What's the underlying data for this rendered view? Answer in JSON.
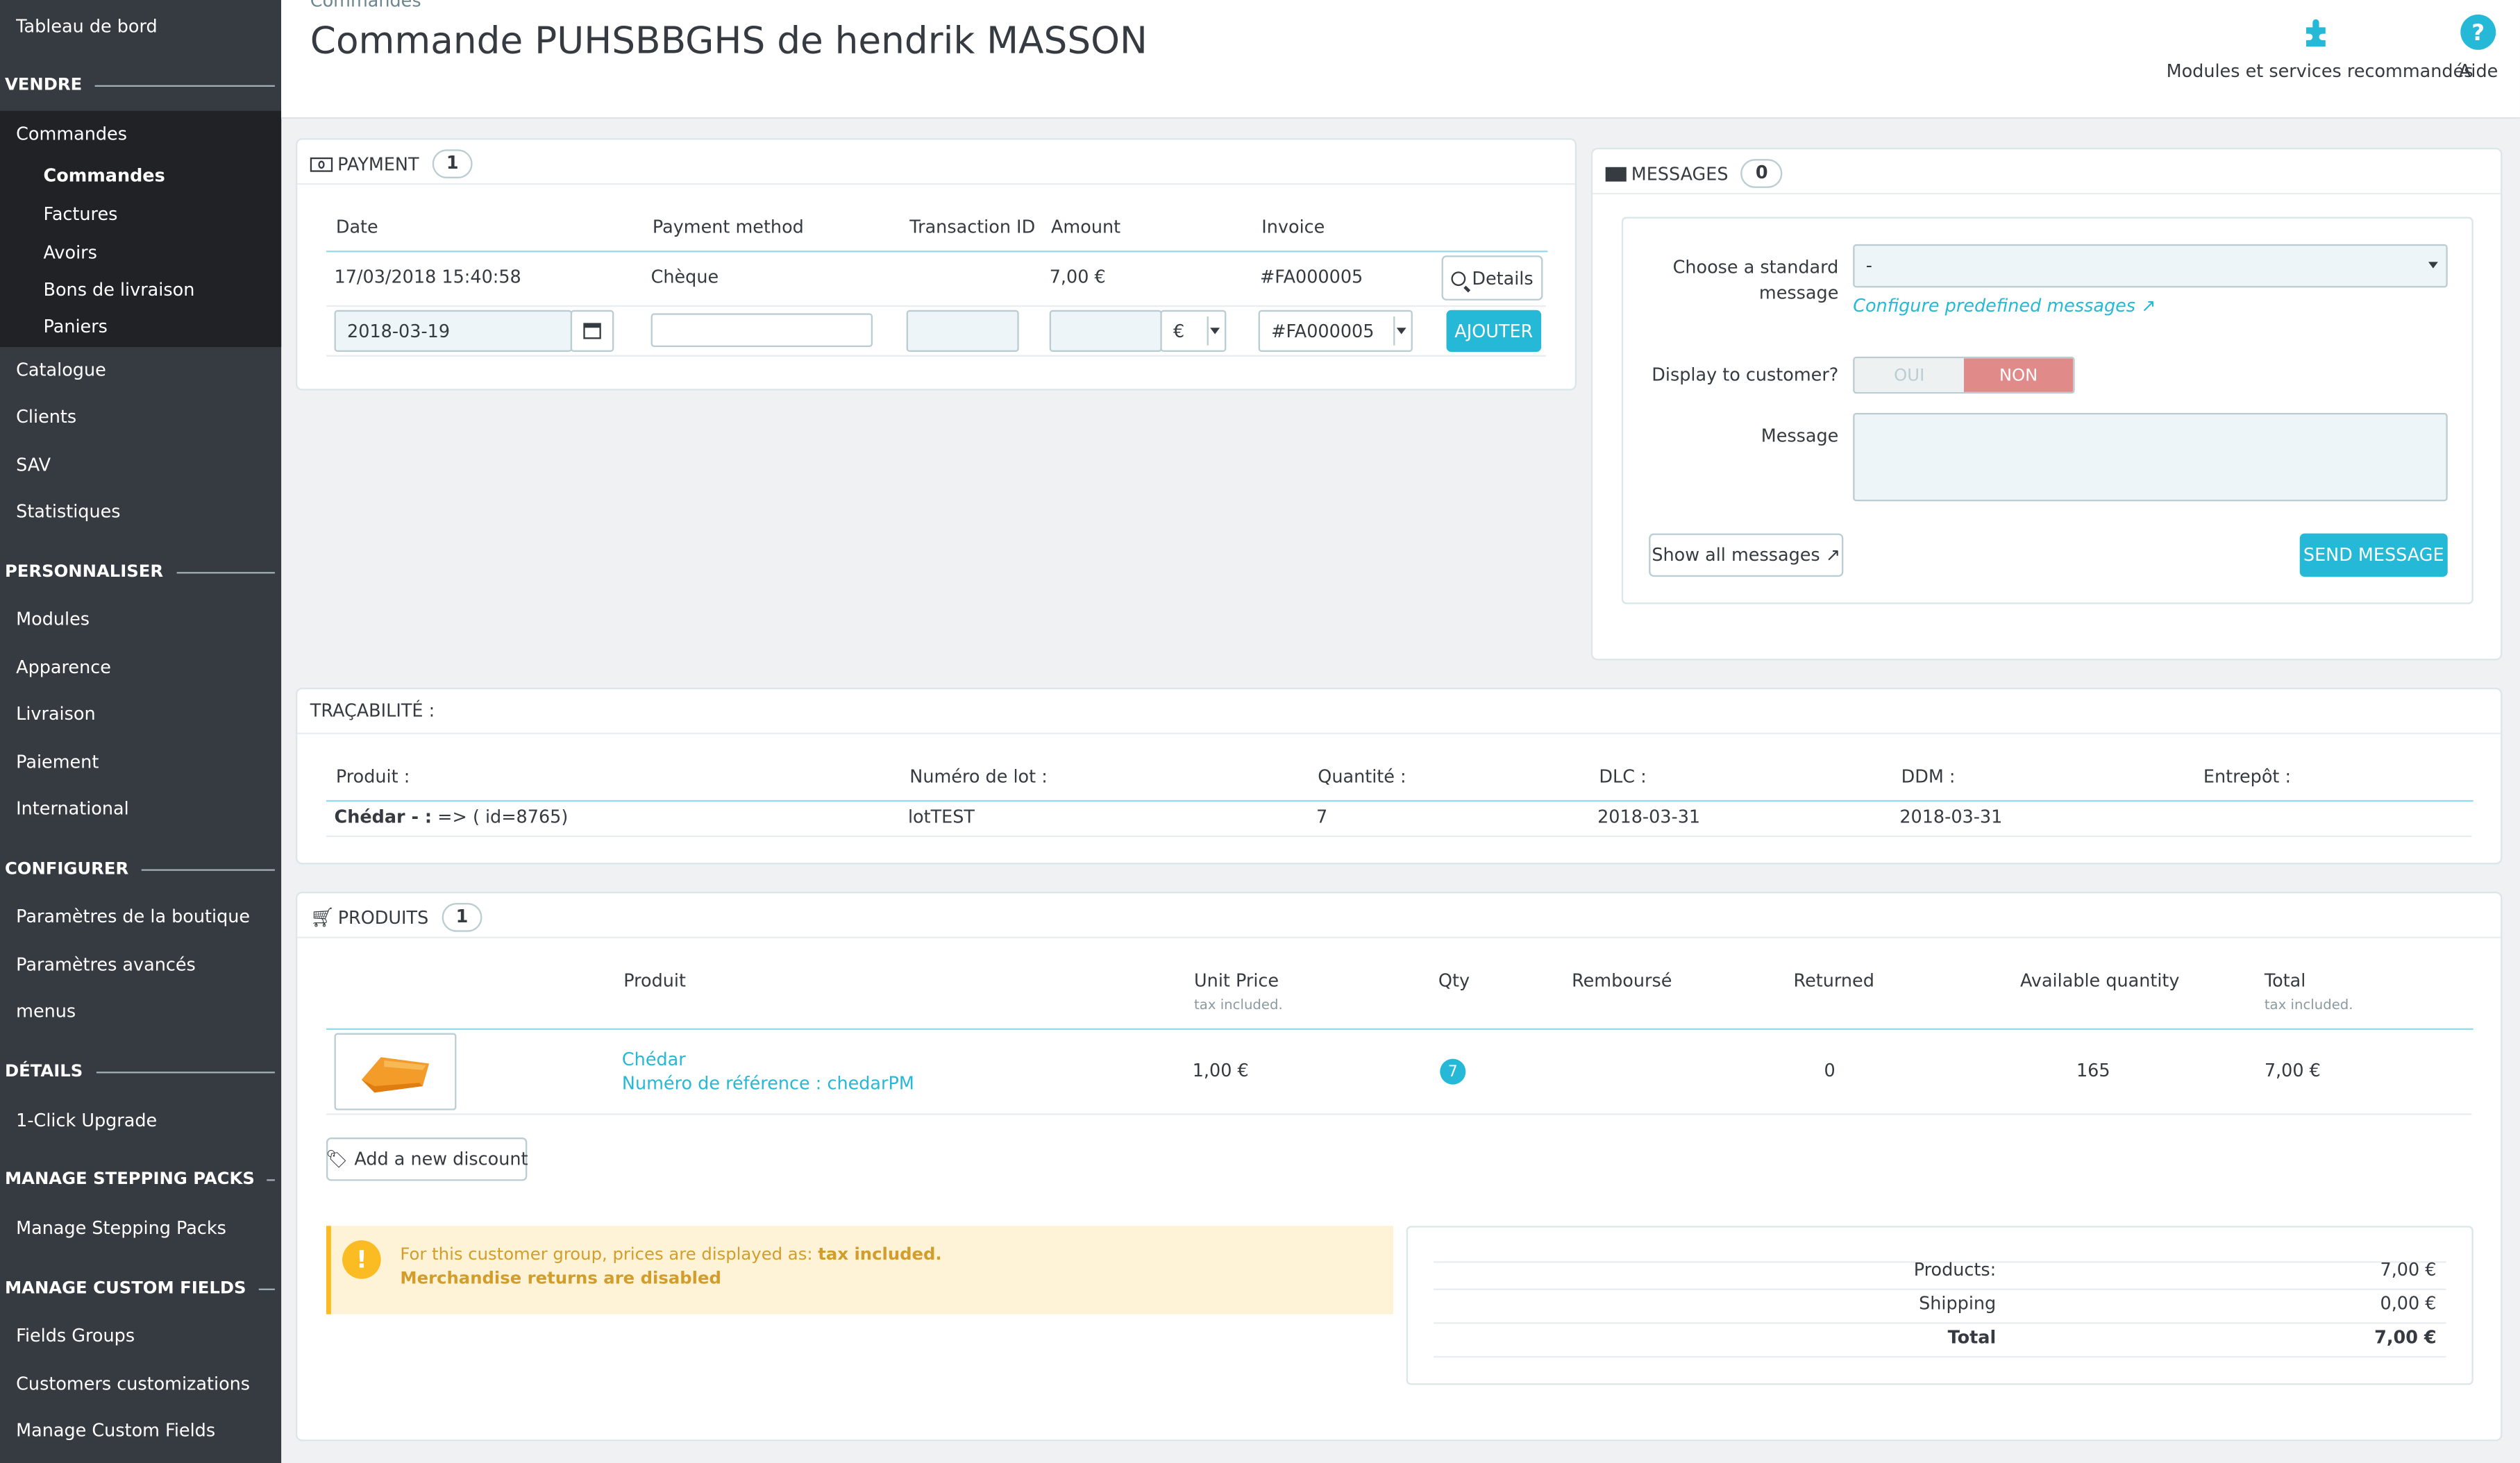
{
  "sidebar": {
    "dashboard": "Tableau de bord",
    "sections": {
      "vendre": "VENDRE",
      "personnaliser": "PERSONNALISER",
      "configurer": "CONFIGURER",
      "details": "DÉTAILS",
      "stepping": "MANAGE STEPPING PACKS",
      "custom_fields": "MANAGE CUSTOM FIELDS"
    },
    "commandes": "Commandes",
    "sub": [
      "Commandes",
      "Factures",
      "Avoirs",
      "Bons de livraison",
      "Paniers"
    ],
    "vendre_items": [
      "Catalogue",
      "Clients",
      "SAV",
      "Statistiques"
    ],
    "personnaliser_items": [
      "Modules",
      "Apparence",
      "Livraison",
      "Paiement",
      "International"
    ],
    "configurer_items": [
      "Paramètres de la boutique",
      "Paramètres avancés",
      "menus"
    ],
    "details_items": [
      "1-Click Upgrade"
    ],
    "stepping_items": [
      "Manage Stepping Packs"
    ],
    "custom_items": [
      "Fields Groups",
      "Customers customizations",
      "Manage Custom Fields"
    ]
  },
  "header": {
    "breadcrumb": "Commandes",
    "title": "Commande PUHSBBGHS de hendrik MASSON",
    "modules_label": "Modules et services recommandés",
    "help_label": "Aide"
  },
  "payment": {
    "title": "PAYMENT",
    "count": "1",
    "columns": [
      "Date",
      "Payment method",
      "Transaction ID",
      "Amount",
      "Invoice"
    ],
    "row": {
      "date": "17/03/2018 15:40:58",
      "method": "Chèque",
      "transaction": "",
      "amount": "7,00 €",
      "invoice": "#FA000005"
    },
    "details_button": "Details",
    "form": {
      "date": "2018-03-19",
      "currency": "€",
      "invoice": "#FA000005",
      "add_button": "AJOUTER"
    }
  },
  "messages": {
    "title": "MESSAGES",
    "count": "0",
    "standard_label_1": "Choose a standard",
    "standard_label_2": "message",
    "standard_value": "-",
    "configure_link": "Configure predefined messages",
    "display_label": "Display to customer?",
    "oui": "OUI",
    "non": "NON",
    "message_label": "Message",
    "show_all": "Show all messages",
    "send": "SEND MESSAGE"
  },
  "traceability": {
    "title": "TRAÇABILITÉ :",
    "columns": [
      "Produit :",
      "Numéro de lot :",
      "Quantité :",
      "DLC :",
      "DDM :",
      "Entrepôt :"
    ],
    "row": {
      "product_bold": "Chédar - :",
      "product_rest": " => ( id=8765)",
      "lot": "lotTEST",
      "qty": "7",
      "dlc": "2018-03-31",
      "ddm": "2018-03-31",
      "warehouse": ""
    }
  },
  "products": {
    "title": "PRODUITS",
    "count": "1",
    "columns": {
      "product": "Produit",
      "unit_price": "Unit Price",
      "unit_price_sub": "tax included.",
      "qty": "Qty",
      "refunded": "Remboursé",
      "returned": "Returned",
      "available": "Available quantity",
      "total": "Total",
      "total_sub": "tax included."
    },
    "row": {
      "name": "Chédar",
      "reference": "Numéro de référence : chedarPM",
      "unit_price": "1,00 €",
      "qty": "7",
      "returned": "0",
      "available": "165",
      "total": "7,00 €"
    },
    "add_discount": "Add a new discount",
    "warning_line1": "For this customer group, prices are displayed as: ",
    "warning_bold": "tax included.",
    "warning_line2": "Merchandise returns are disabled",
    "totals": [
      {
        "label": "Products:",
        "value": "7,00 €"
      },
      {
        "label": "Shipping",
        "value": "0,00 €"
      },
      {
        "label": "Total",
        "value": "7,00 €"
      }
    ]
  },
  "colors": {
    "sidebar": "#363a41",
    "accent": "#25b9d7",
    "non": "#e08a8a",
    "warning_bg": "#fff3d7",
    "warning_icon": "#fbbb22"
  }
}
